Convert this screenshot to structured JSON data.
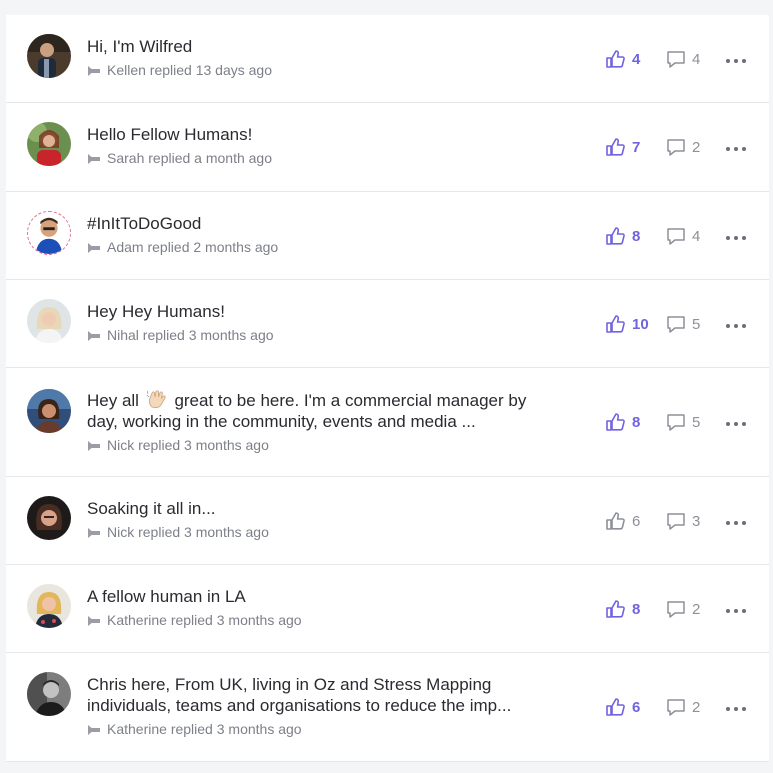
{
  "colors": {
    "accent": "#6f63e0",
    "muted": "#8d9099"
  },
  "posts": [
    {
      "title": "Hi, I'm Wilfred",
      "meta": "Kellen replied 13 days ago",
      "likes": "4",
      "comments": "4",
      "liked": true
    },
    {
      "title": "Hello Fellow Humans!",
      "meta": "Sarah replied a month ago",
      "likes": "7",
      "comments": "2",
      "liked": true
    },
    {
      "title": "#InItToDoGood",
      "meta": "Adam replied 2 months ago",
      "likes": "8",
      "comments": "4",
      "liked": true
    },
    {
      "title": "Hey Hey Humans!",
      "meta": "Nihal replied 3 months ago",
      "likes": "10",
      "comments": "5",
      "liked": true
    },
    {
      "title_before": "Hey all",
      "emoji": "waving-hand-icon",
      "title_after": "great to be here. I'm a commercial manager by day, working in the community, events and media ...",
      "meta": "Nick replied 3 months ago",
      "likes": "8",
      "comments": "5",
      "liked": true
    },
    {
      "title": "Soaking it all in...",
      "meta": "Nick replied 3 months ago",
      "likes": "6",
      "comments": "3",
      "liked": false
    },
    {
      "title": "A fellow human in LA",
      "meta": "Katherine replied 3 months ago",
      "likes": "8",
      "comments": "2",
      "liked": true
    },
    {
      "title": "Chris here, From UK, living in Oz and Stress Mapping individuals, teams and organisations to reduce the imp...",
      "meta": "Katherine replied 3 months ago",
      "likes": "6",
      "comments": "2",
      "liked": true
    }
  ]
}
